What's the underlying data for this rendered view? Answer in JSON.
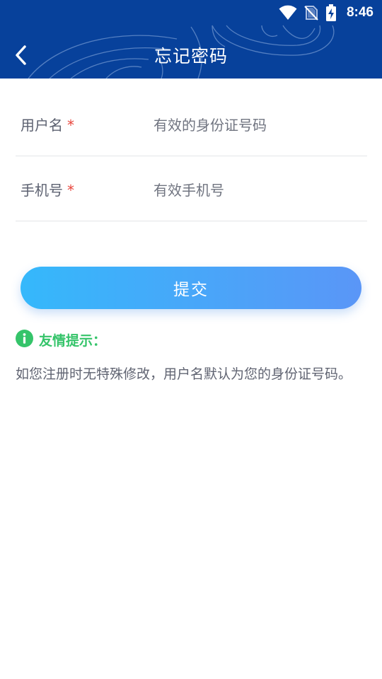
{
  "status_bar": {
    "time": "8:46",
    "icons": [
      "wifi-icon",
      "no-sim-icon",
      "battery-charging-icon"
    ]
  },
  "header": {
    "title": "忘记密码",
    "back_icon": "chevron-left-icon"
  },
  "form": {
    "username": {
      "label": "用户名",
      "required_mark": "*",
      "placeholder": "有效的身份证号码",
      "value": ""
    },
    "phone": {
      "label": "手机号",
      "required_mark": "*",
      "placeholder": "有效手机号",
      "value": ""
    }
  },
  "submit": {
    "label": "提交"
  },
  "tips": {
    "icon": "info-icon",
    "title": "友情提示：",
    "body": "如您注册时无特殊修改，用户名默认为您的身份证号码。"
  },
  "colors": {
    "header_bg": "#07419b",
    "button_gradient_start": "#35b8fb",
    "button_gradient_end": "#5a96f7",
    "required": "#e8453c",
    "tip_green": "#35c46a"
  }
}
